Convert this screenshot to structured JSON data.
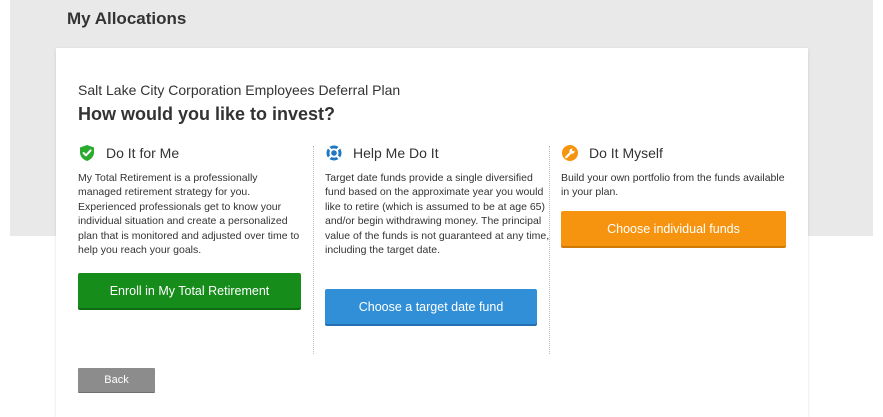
{
  "page": {
    "title": "My Allocations"
  },
  "card": {
    "plan_name": "Salt Lake City Corporation Employees Deferral Plan",
    "question": "How would you like to invest?"
  },
  "options": [
    {
      "icon": "shield-check-icon",
      "title": "Do It for Me",
      "description": "My Total Retirement is a professionally managed retirement strategy for you. Experienced professionals get to know your individual situation and create a personalized plan that is monitored and adjusted over time to help you reach your goals.",
      "button": "Enroll in My Total Retirement",
      "color": "#168c1b"
    },
    {
      "icon": "lifebuoy-icon",
      "title": "Help Me Do It",
      "description": "Target date funds provide a single diversified fund based on the approximate year you would like to retire (which is assumed to be at age 65) and/or begin withdrawing money. The principal value of the funds is not guaranteed at any time, including the target date.",
      "button": "Choose a target date fund",
      "color": "#318fd8"
    },
    {
      "icon": "wrench-icon",
      "title": "Do It Myself",
      "description": "Build your own portfolio from the funds available in your plan.",
      "button": "Choose individual funds",
      "color": "#f7940f"
    }
  ],
  "footer": {
    "back_label": "Back"
  },
  "colors": {
    "band": "#e9e9e9",
    "text": "#333333",
    "back_button": "#8c8c8c"
  }
}
